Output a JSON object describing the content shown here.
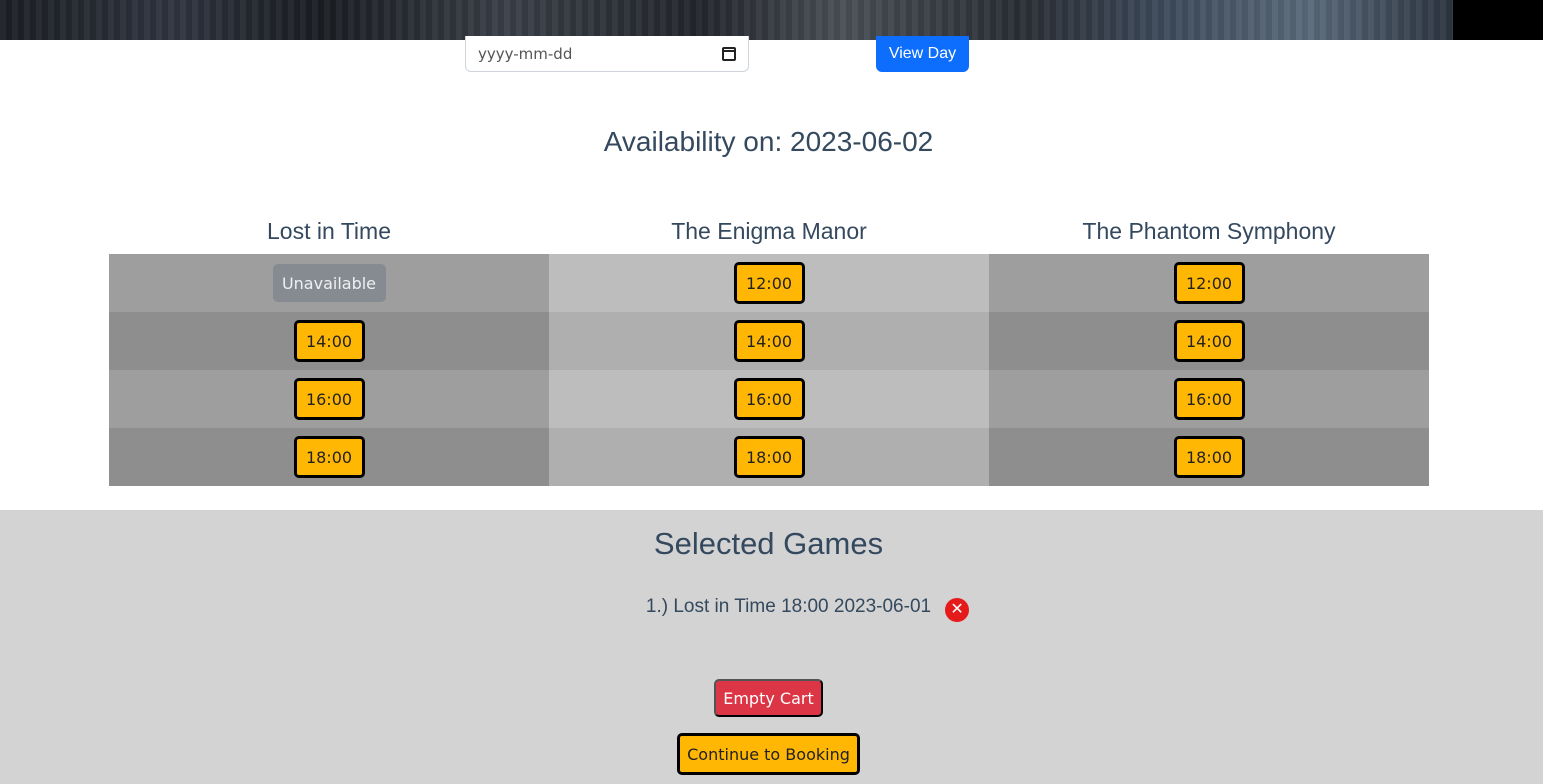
{
  "header": {
    "date_input": {
      "placeholder": "yyyy-mm-dd",
      "value": ""
    },
    "view_day_label": "View Day"
  },
  "availability": {
    "heading": "Availability on: 2023-06-02",
    "rooms": [
      {
        "name": "Lost in Time",
        "slots": [
          "Unavailable",
          "14:00",
          "16:00",
          "18:00"
        ]
      },
      {
        "name": "The Enigma Manor",
        "slots": [
          "12:00",
          "14:00",
          "16:00",
          "18:00"
        ]
      },
      {
        "name": "The Phantom Symphony",
        "slots": [
          "12:00",
          "14:00",
          "16:00",
          "18:00"
        ]
      }
    ]
  },
  "cart": {
    "title": "Selected Games",
    "items": [
      {
        "text": "1.) Lost in Time 18:00 2023-06-01"
      }
    ],
    "empty_label": "Empty Cart",
    "continue_label": "Continue to Booking"
  },
  "colors": {
    "slot_button": "#ffb703",
    "unavailable_button": "#868b91",
    "view_day": "#0d6efd",
    "empty_cart": "#dc3545",
    "remove_icon": "#e51b1b",
    "cart_background": "#d3d3d3"
  },
  "icons": {
    "date_picker": "calendar-icon",
    "remove_item": "close-circle-icon"
  }
}
